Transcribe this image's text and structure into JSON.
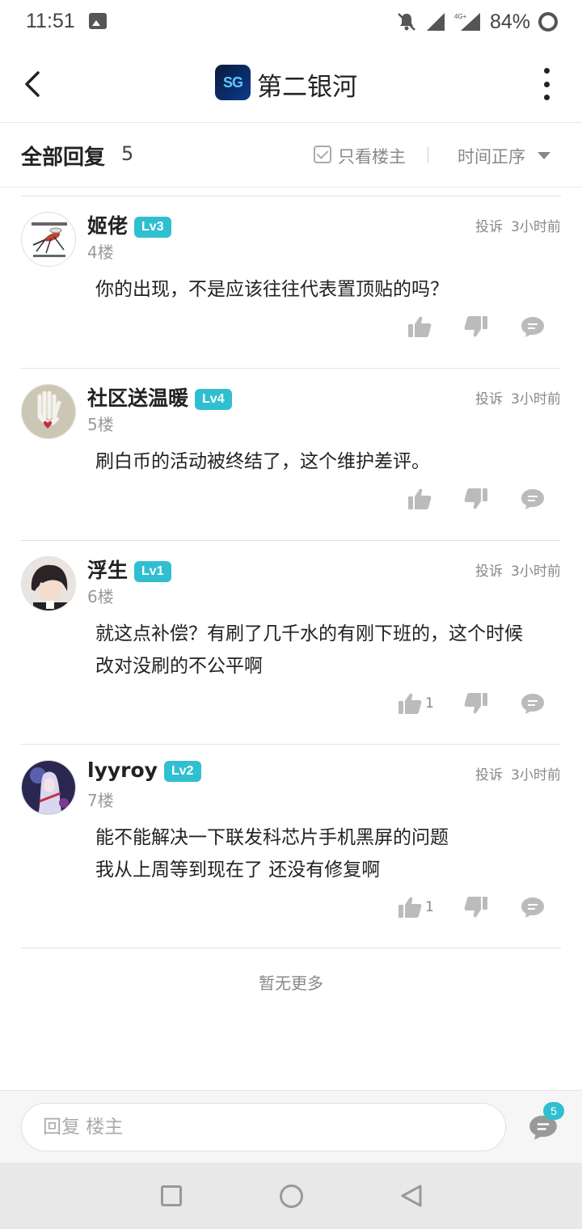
{
  "status_bar": {
    "time": "11:51",
    "battery": "84%",
    "network": "4G+"
  },
  "header": {
    "title": "第二银河",
    "logo_text": "SG"
  },
  "filter": {
    "all_replies": "全部回复",
    "count": "5",
    "only_op": "只看楼主",
    "sort": "时间正序"
  },
  "replies": [
    {
      "name": "姬佬",
      "level": "Lv3",
      "floor": "4楼",
      "report": "投诉",
      "time": "3小时前",
      "content": [
        "你的出现，不是应该往往代表置顶贴的吗？"
      ],
      "likes": ""
    },
    {
      "name": "社区送温暖",
      "level": "Lv4",
      "floor": "5楼",
      "report": "投诉",
      "time": "3小时前",
      "content": [
        "刷白币的活动被终结了，这个维护差评。"
      ],
      "likes": ""
    },
    {
      "name": "浮生",
      "level": "Lv1",
      "floor": "6楼",
      "report": "投诉",
      "time": "3小时前",
      "content": [
        "就这点补偿？有刷了几千水的有刚下班的，这个时候",
        "改对没刷的不公平啊"
      ],
      "likes": "1"
    },
    {
      "name": "lyyroy",
      "level": "Lv2",
      "floor": "7楼",
      "report": "投诉",
      "time": "3小时前",
      "content": [
        "能不能解决一下联发科芯片手机黑屏的问题",
        "我从上周等到现在了 还没有修复啊"
      ],
      "likes": "1"
    }
  ],
  "footer": {
    "no_more": "暂无更多"
  },
  "reply_bar": {
    "placeholder": "回复  楼主",
    "comment_count": "5"
  },
  "colors": {
    "accent": "#30bfd1",
    "text": "#222222",
    "muted": "#888888"
  }
}
